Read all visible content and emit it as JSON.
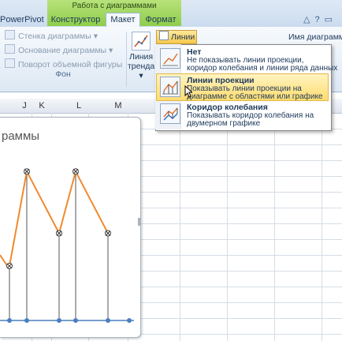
{
  "ribbon": {
    "context_title": "Работа с диаграммами",
    "tabs": [
      {
        "label": "PowerPivot"
      },
      {
        "label": "Конструктор"
      },
      {
        "label": "Макет"
      },
      {
        "label": "Формат"
      }
    ],
    "active_tab": "Макет",
    "left_group": {
      "items": [
        {
          "label": "Стенка диаграммы ▾",
          "icon": "chart-wall-icon"
        },
        {
          "label": "Основание диаграммы ▾",
          "icon": "chart-floor-icon"
        },
        {
          "label": "Поворот объемной фигуры",
          "icon": "3d-rotation-icon"
        }
      ],
      "group_label": "Фон"
    },
    "trendline_button": {
      "label_line1": "Линия",
      "label_line2": "тренда ▾"
    },
    "lines_button": {
      "label": "Линии ▾"
    },
    "chart_name_label": "Имя диаграммы"
  },
  "lines_menu": {
    "items": [
      {
        "title": "Нет",
        "desc1": "Не показывать линии проекции,",
        "desc2": "коридор колебания и линии ряда данных",
        "highlighted": false
      },
      {
        "title": "Линии проекции",
        "desc1": "Показывать линии проекции на",
        "desc2": "диаграмме с областями или графике",
        "highlighted": true
      },
      {
        "title": "Коридор колебания",
        "desc1": "Показывать коридор колебания на",
        "desc2": "двумерном графике",
        "highlighted": false
      }
    ]
  },
  "sheet": {
    "columns": [
      "J",
      "K",
      "L",
      "M"
    ]
  },
  "chart": {
    "title_fragment": "раммы"
  },
  "chart_data": {
    "type": "line",
    "series": [
      {
        "name": "",
        "values": [
          1.5,
          4.1,
          2.4,
          4.1,
          2.4
        ],
        "color": "#f08a2c"
      }
    ],
    "projection_lines": true,
    "projection_color": "#555555",
    "baseline_color": "#4a7fc0"
  }
}
